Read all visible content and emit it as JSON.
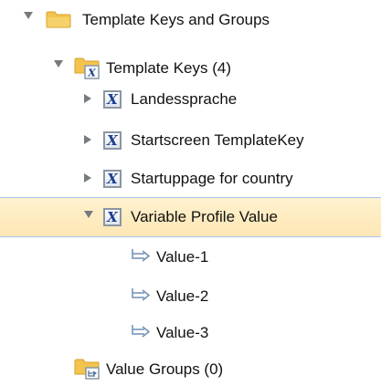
{
  "tree": {
    "root": {
      "label": "Template Keys and Groups",
      "icon": "folder-icon",
      "expanded": true
    },
    "template_keys": {
      "label": "Template Keys (4)",
      "icon": "template-keys-folder-icon",
      "expanded": true
    },
    "keys": [
      {
        "label": "Landessprache",
        "icon": "template-key-icon",
        "expanded": false
      },
      {
        "label": "Startscreen TemplateKey",
        "icon": "template-key-icon",
        "expanded": false
      },
      {
        "label": "Startuppage for country",
        "icon": "template-key-icon",
        "expanded": false
      },
      {
        "label": "Variable Profile Value",
        "icon": "template-key-icon",
        "expanded": true,
        "selected": true
      }
    ],
    "values": [
      {
        "label": "Value-1",
        "icon": "value-arrow-icon"
      },
      {
        "label": "Value-2",
        "icon": "value-arrow-icon"
      },
      {
        "label": "Value-3",
        "icon": "value-arrow-icon"
      }
    ],
    "value_groups": {
      "label": "Value Groups (0)",
      "icon": "value-groups-folder-icon"
    }
  },
  "colors": {
    "selection_background": "#fde6b4",
    "selection_border": "#a9c5ea",
    "folder": "#f3c44d",
    "key_icon_letter": "#1a3d8f",
    "value_arrow": "#6f8fb3"
  }
}
